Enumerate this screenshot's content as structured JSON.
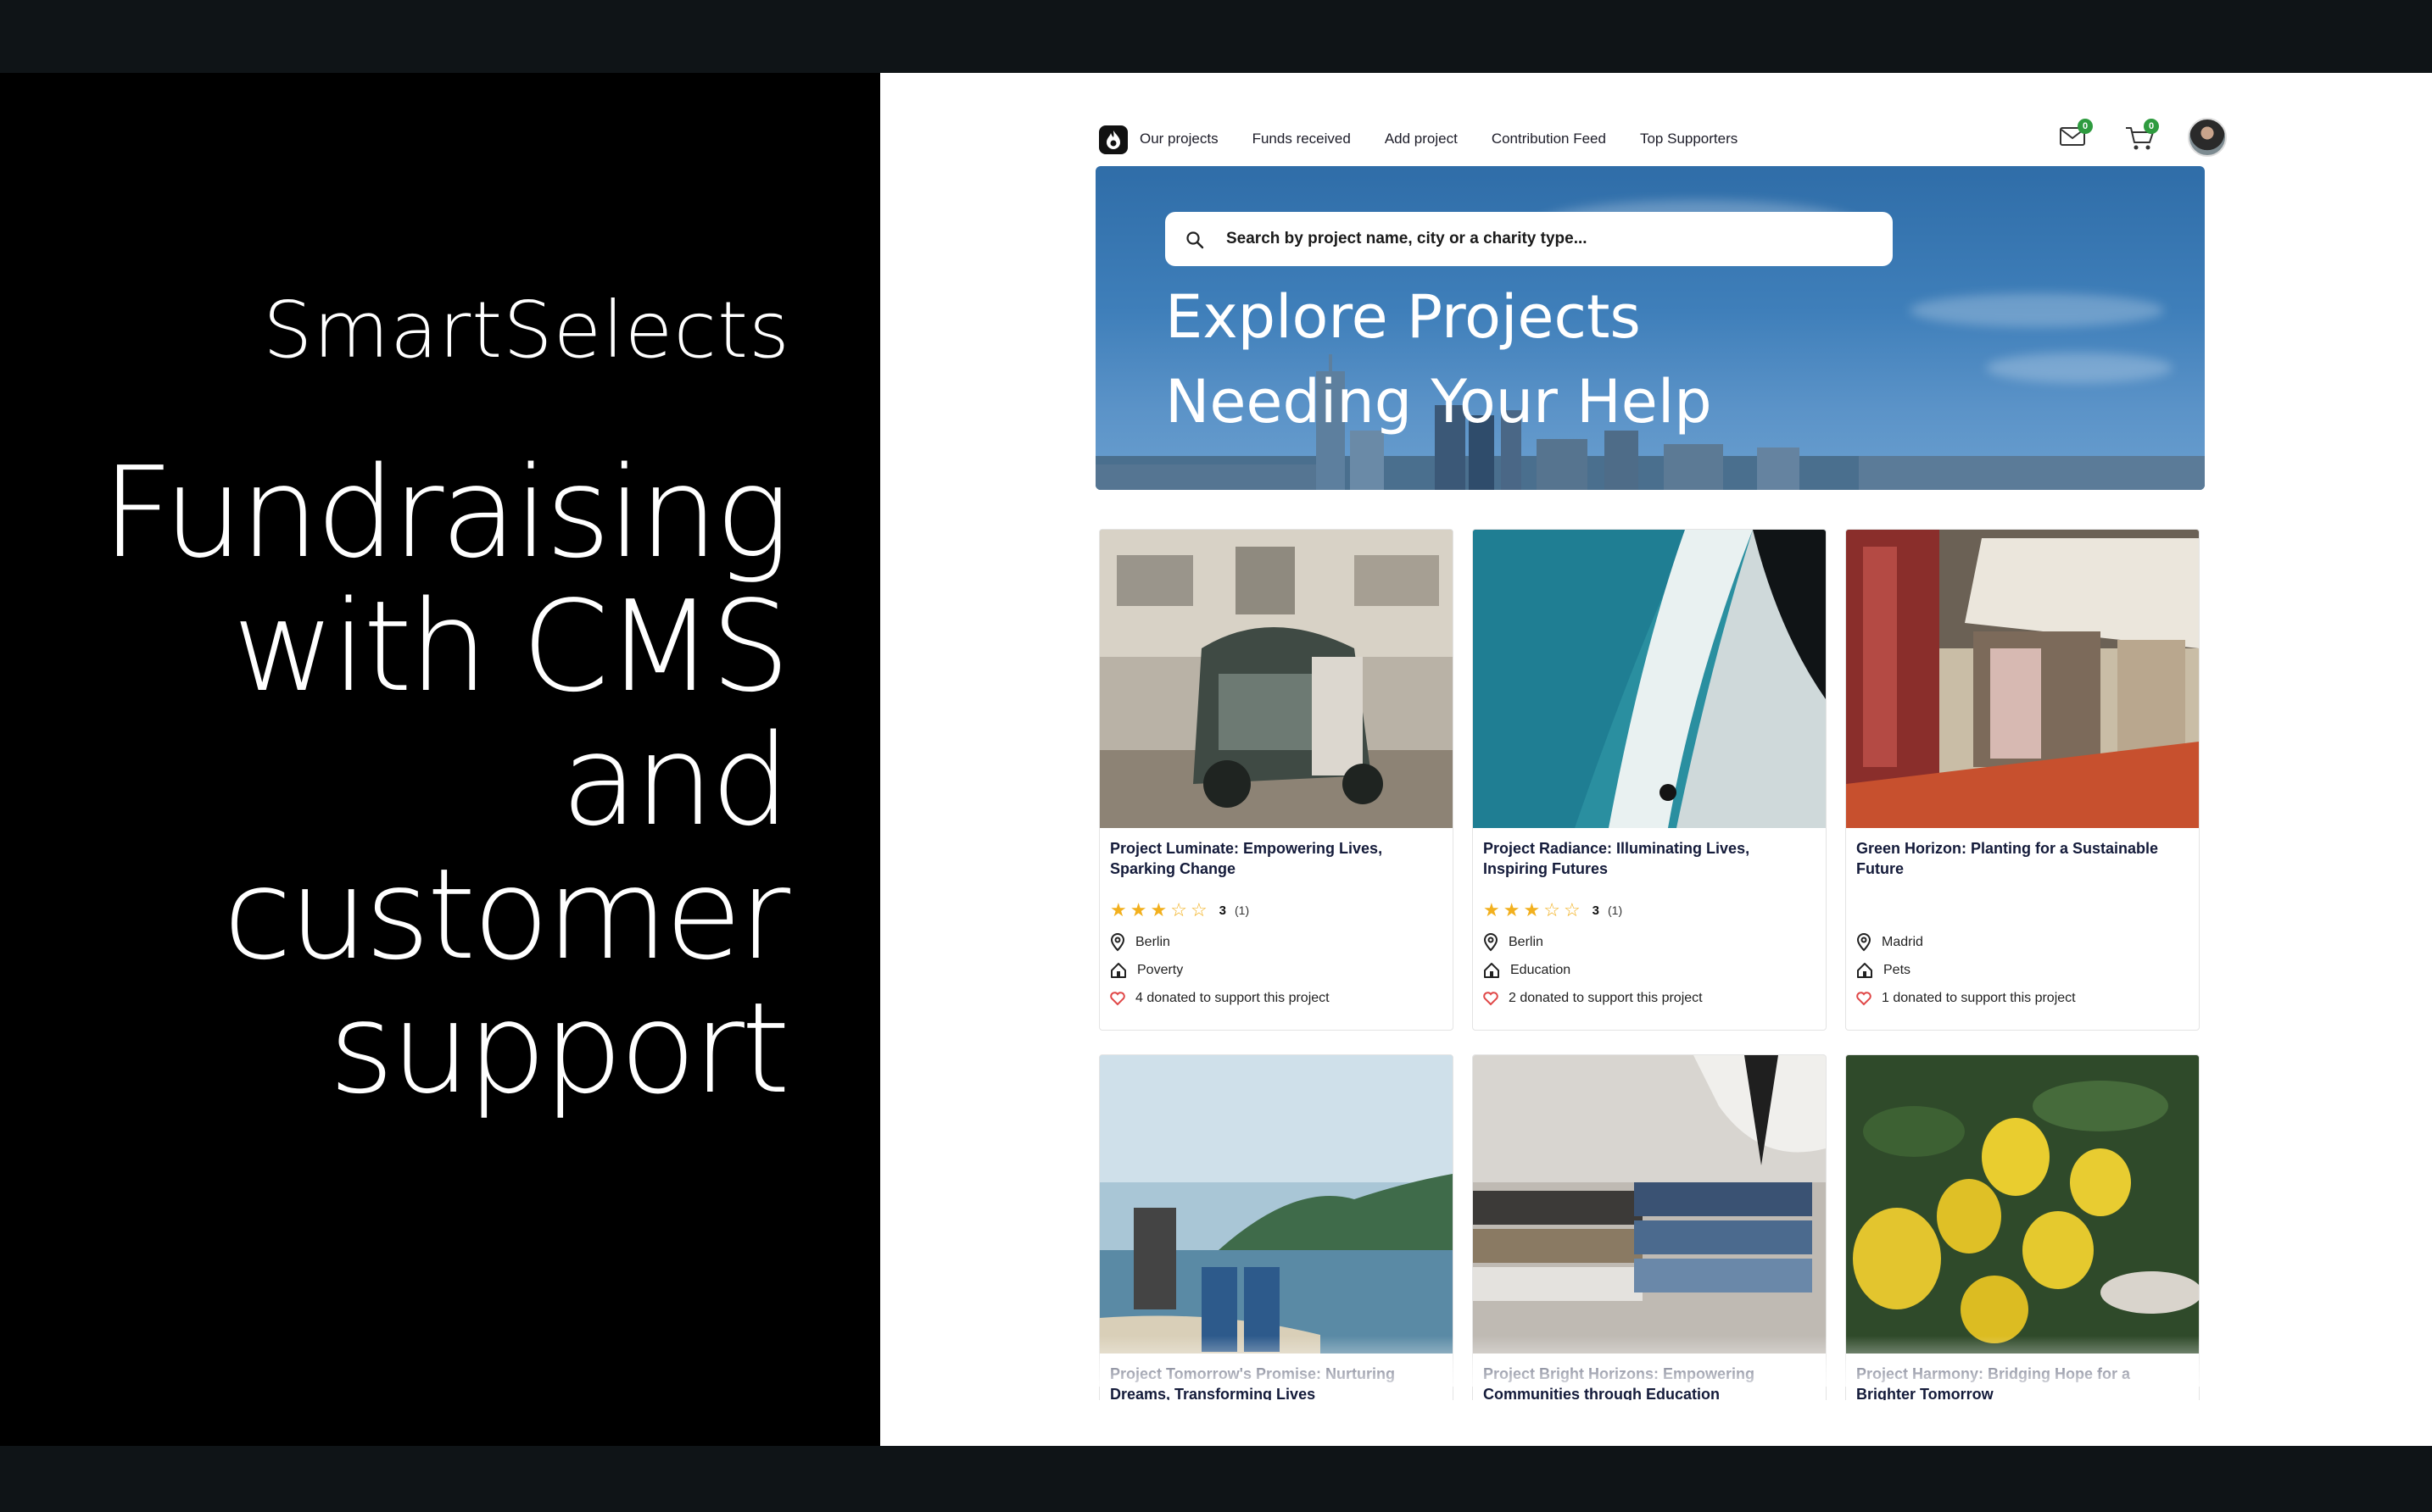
{
  "slide": {
    "brand": "SmartSelects",
    "headline": "Fundraising with CMS and customer support"
  },
  "nav": {
    "links": [
      "Our projects",
      "Funds received",
      "Add project",
      "Contribution Feed",
      "Top Supporters"
    ],
    "mail_badge": "0",
    "cart_badge": "0"
  },
  "hero": {
    "search_placeholder": "Search by project name, city or a charity type...",
    "title_line1": "Explore Projects",
    "title_line2": "Needing Your Help"
  },
  "cards": [
    {
      "title": "Project Luminate: Empowering Lives, Sparking Change",
      "rating": "3",
      "rating_count": "(1)",
      "stars": 3,
      "city": "Berlin",
      "category": "Poverty",
      "donations": "4 donated to support this project",
      "image": "rickshaw-street-photo"
    },
    {
      "title": "Project Radiance: Illuminating Lives, Inspiring Futures",
      "rating": "3",
      "rating_count": "(1)",
      "stars": 3,
      "city": "Berlin",
      "category": "Education",
      "donations": "2 donated to support this project",
      "image": "ocean-waves-aerial-photo"
    },
    {
      "title": "Green Horizon: Planting for a Sustainable Future",
      "rating": "",
      "rating_count": "",
      "stars": 0,
      "city": "Madrid",
      "category": "Pets",
      "donations": "1 donated to support this project",
      "image": "storefront-street-photo"
    },
    {
      "title": "Project Tomorrow's Promise: Nurturing Dreams, Transforming Lives",
      "image": "coast-trash-bins-photo"
    },
    {
      "title": "Project Bright Horizons: Empowering Communities through Education",
      "image": "folded-clothes-photo"
    },
    {
      "title": "Project Harmony: Bridging Hope for a Brighter Tomorrow",
      "image": "lemon-tree-photo"
    }
  ],
  "colors": {
    "accent_star": "#f2b01e",
    "badge_green": "#2e9b3f",
    "title_navy": "#141b3a",
    "heart_red": "#e04848"
  }
}
